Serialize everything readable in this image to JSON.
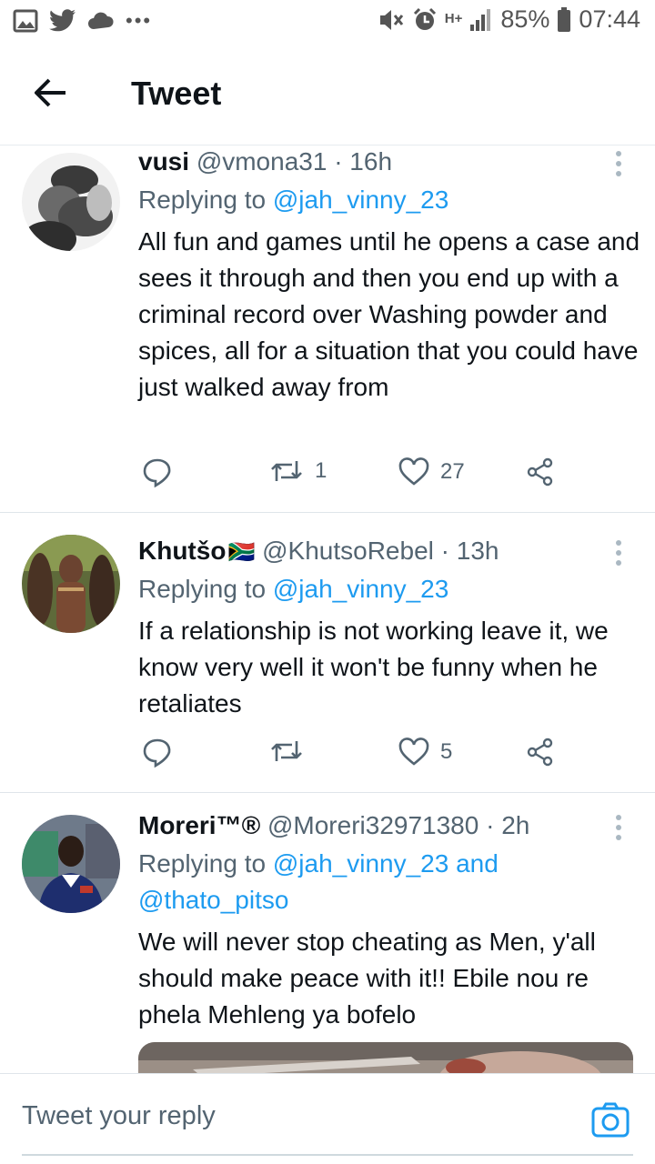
{
  "status_bar": {
    "overflow": "•••",
    "network": "H+",
    "battery": "85%",
    "time": "07:44"
  },
  "header": {
    "title": "Tweet"
  },
  "tweets": [
    {
      "name": "vusi",
      "handle": "@vmona31",
      "time": "· 16h",
      "replying_prefix": "Replying to ",
      "replying_to": "@jah_vinny_23",
      "body": "All fun and games until he opens a case and sees it through and then you end up with a criminal record over Washing powder and spices, all for a situation that you could have just walked away from",
      "retweets": "1",
      "likes": "27"
    },
    {
      "name": "Khutšo",
      "flag": "🇿🇦",
      "handle": "@KhutsoRebel",
      "time": "· 13h",
      "replying_prefix": "Replying to ",
      "replying_to": "@jah_vinny_23",
      "body": "If a relationship is not working leave it, we know very well it won't be funny when he retaliates",
      "retweets": "",
      "likes": "5"
    },
    {
      "name": "Moreri™®",
      "handle": "@Moreri32971380",
      "time": "· 2h",
      "replying_prefix": "Replying to ",
      "replying_to": "@jah_vinny_23 and @thato_pitso",
      "body": "We will never stop cheating as Men, y'all should make peace with it!! Ebile nou re phela Mehleng ya bofelo"
    }
  ],
  "reply_bar": {
    "placeholder": "Tweet your reply"
  },
  "colors": {
    "accent": "#1d9bf0",
    "text": "#0f1419",
    "muted": "#536471"
  }
}
